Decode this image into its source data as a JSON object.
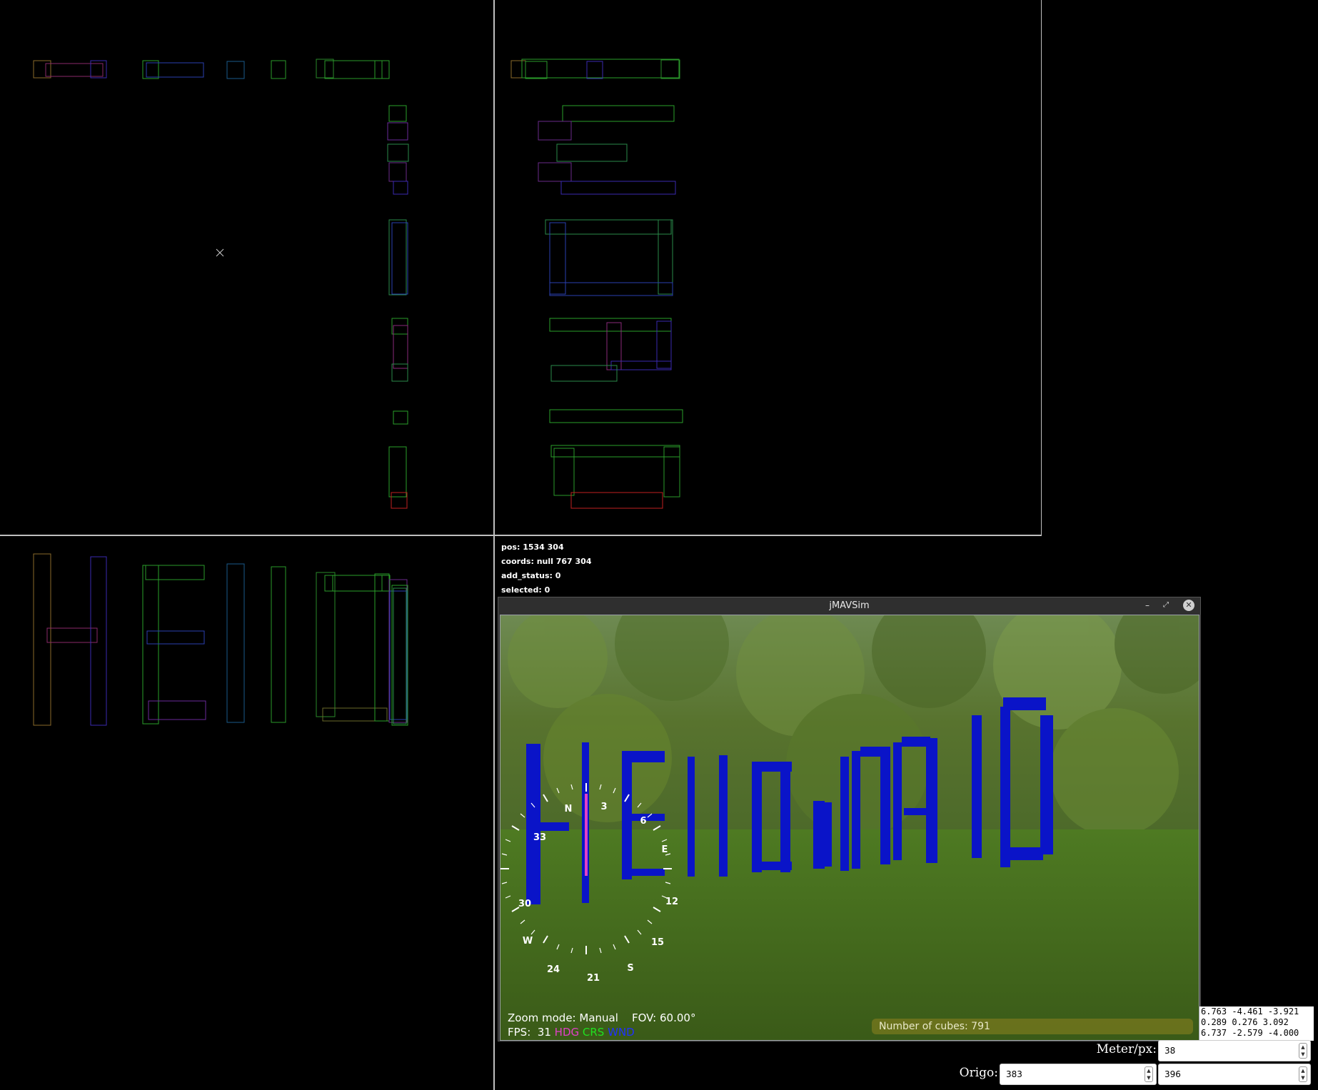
{
  "status_lines": {
    "pos": "pos: 1534 304",
    "coords": "coords: null 767 304",
    "add_status": "add_status: 0",
    "selected": "selected: 0"
  },
  "sim_window": {
    "title": "jMAVSim",
    "minimize_icon": "minimize-icon",
    "restore_icon": "restore-icon",
    "close_icon": "close-icon",
    "scene_text": "HEllOWORlD",
    "hud": {
      "zoom_mode": "Zoom mode: Manual",
      "fov": "FOV: 60.00°",
      "fps_label": "FPS:",
      "fps_value": "31",
      "hdg": "HDG",
      "crs": "CRS",
      "wnd": "WND",
      "cubes": "Number of cubes: 791"
    },
    "compass": {
      "labels": [
        "N",
        "3",
        "6",
        "E",
        "12",
        "15",
        "S",
        "21",
        "24",
        "W",
        "30",
        "33"
      ]
    },
    "colors": {
      "cubes": "#0a14c8",
      "hdg": "#e040c8",
      "crs": "#20e020",
      "wnd": "#2030ff"
    }
  },
  "coords_box": {
    "lines": [
      "6.763 -4.461 -3.921",
      "0.289 0.276 3.092",
      "6.737 -2.579 -4.000"
    ]
  },
  "meter_per_px": {
    "label": "Meter/px:",
    "value": "38"
  },
  "origo": {
    "label": "Origo:",
    "x": "383",
    "y": "396"
  }
}
